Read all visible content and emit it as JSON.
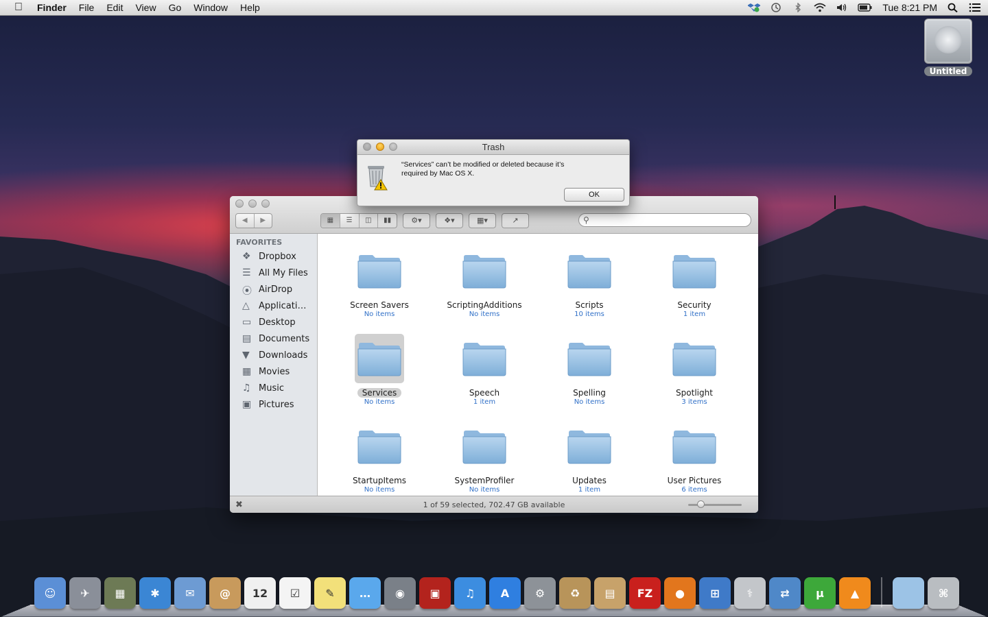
{
  "menubar": {
    "app_name": "Finder",
    "items": [
      "File",
      "Edit",
      "View",
      "Go",
      "Window",
      "Help"
    ],
    "clock": "Tue 8:21 PM"
  },
  "desktop": {
    "drive_label": "Untitled"
  },
  "alert": {
    "title": "Trash",
    "message_line1": "“Services” can’t be modified or deleted because it’s",
    "message_line2": "required by Mac OS X.",
    "ok_label": "OK"
  },
  "finder": {
    "sidebar_header": "FAVORITES",
    "sidebar": [
      {
        "label": "Dropbox",
        "icon": "dropbox-icon"
      },
      {
        "label": "All My Files",
        "icon": "all-files-icon"
      },
      {
        "label": "AirDrop",
        "icon": "airdrop-icon"
      },
      {
        "label": "Applicati…",
        "icon": "applications-icon"
      },
      {
        "label": "Desktop",
        "icon": "desktop-icon"
      },
      {
        "label": "Documents",
        "icon": "documents-icon"
      },
      {
        "label": "Downloads",
        "icon": "downloads-icon"
      },
      {
        "label": "Movies",
        "icon": "movies-icon"
      },
      {
        "label": "Music",
        "icon": "music-icon"
      },
      {
        "label": "Pictures",
        "icon": "pictures-icon"
      }
    ],
    "folders": [
      {
        "name": "Screen Savers",
        "sub": "No items",
        "selected": false
      },
      {
        "name": "ScriptingAdditions",
        "sub": "No items",
        "selected": false
      },
      {
        "name": "Scripts",
        "sub": "10 items",
        "selected": false
      },
      {
        "name": "Security",
        "sub": "1 item",
        "selected": false
      },
      {
        "name": "Services",
        "sub": "No items",
        "selected": true
      },
      {
        "name": "Speech",
        "sub": "1 item",
        "selected": false
      },
      {
        "name": "Spelling",
        "sub": "No items",
        "selected": false
      },
      {
        "name": "Spotlight",
        "sub": "3 items",
        "selected": false
      },
      {
        "name": "StartupItems",
        "sub": "No items",
        "selected": false
      },
      {
        "name": "SystemProfiler",
        "sub": "No items",
        "selected": false
      },
      {
        "name": "Updates",
        "sub": "1 item",
        "selected": false
      },
      {
        "name": "User Pictures",
        "sub": "6 items",
        "selected": false
      }
    ],
    "status": "1 of 59 selected, 702.47 GB available",
    "icon_size_level": 0.2
  },
  "colors": {
    "folder": "#9cc3e6",
    "accent_blue": "#2f6fc7"
  },
  "dock": [
    {
      "name": "finder",
      "color": "#5b8fd6",
      "glyph": "☺"
    },
    {
      "name": "launchpad",
      "color": "#8a8f99",
      "glyph": "✈"
    },
    {
      "name": "mission-control",
      "color": "#6d7a55",
      "glyph": "▦"
    },
    {
      "name": "safari",
      "color": "#3b86d4",
      "glyph": "✱"
    },
    {
      "name": "mail-eagle",
      "color": "#6d9bd3",
      "glyph": "✉"
    },
    {
      "name": "contacts",
      "color": "#c89a5c",
      "glyph": "@"
    },
    {
      "name": "calendar",
      "color": "#f0f0f0",
      "glyph": "12"
    },
    {
      "name": "reminders",
      "color": "#f4f4f4",
      "glyph": "☑"
    },
    {
      "name": "notes",
      "color": "#f2e07a",
      "glyph": "✎"
    },
    {
      "name": "messages",
      "color": "#5aa8ec",
      "glyph": "…"
    },
    {
      "name": "facetime",
      "color": "#7a8088",
      "glyph": "◉"
    },
    {
      "name": "photo-booth",
      "color": "#b3231d",
      "glyph": "▣"
    },
    {
      "name": "itunes",
      "color": "#3c8de0",
      "glyph": "♫"
    },
    {
      "name": "app-store",
      "color": "#2f7fe0",
      "glyph": "A"
    },
    {
      "name": "system-preferences",
      "color": "#8d9298",
      "glyph": "⚙"
    },
    {
      "name": "recycle",
      "color": "#b8945a",
      "glyph": "♻"
    },
    {
      "name": "compress",
      "color": "#c7a26a",
      "glyph": "▤"
    },
    {
      "name": "filezilla",
      "color": "#c9201d",
      "glyph": "FZ"
    },
    {
      "name": "firefox",
      "color": "#e2761d",
      "glyph": "●"
    },
    {
      "name": "boot-camp",
      "color": "#3f7ac8",
      "glyph": "⊞"
    },
    {
      "name": "disk-utility",
      "color": "#c3c6ca",
      "glyph": "⚕"
    },
    {
      "name": "migration",
      "color": "#4f88c8",
      "glyph": "⇄"
    },
    {
      "name": "utorrent",
      "color": "#3da83a",
      "glyph": "µ"
    },
    {
      "name": "vlc",
      "color": "#f08a1c",
      "glyph": "▲"
    },
    {
      "name": "documents-stack",
      "color": "#9cc3e6",
      "glyph": ""
    },
    {
      "name": "trash",
      "color": "#b9bdc1",
      "glyph": "⌘"
    }
  ]
}
